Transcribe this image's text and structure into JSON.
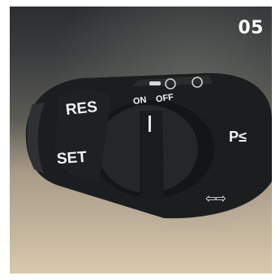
{
  "photo": {
    "badge_number": "05",
    "labels": {
      "res": "RES",
      "set": "SET",
      "on": "ON",
      "off": "OFF",
      "parking_symbol": "P≤"
    },
    "arrows_symbol": "⇦⇨"
  },
  "colors": {
    "stalk": "#1c1d1f",
    "label_text": "#f2f2f2",
    "background_top": "#2b2e30",
    "background_bottom": "#d8c8ae"
  }
}
